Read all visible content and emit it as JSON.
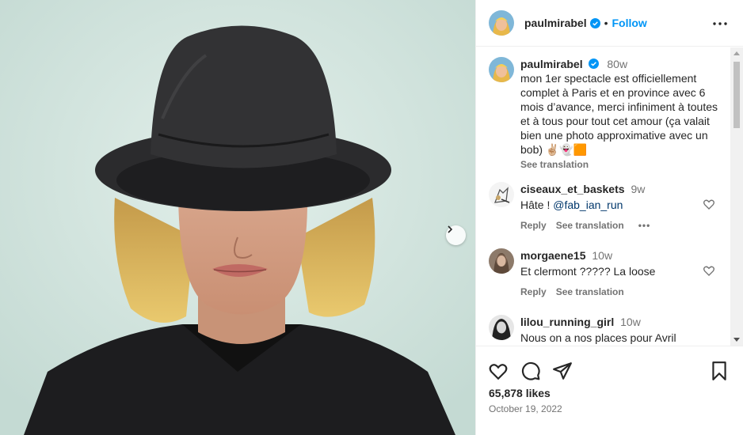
{
  "post": {
    "username": "paulmirabel",
    "follow_label": "Follow",
    "separator": "•",
    "caption_time": "80w",
    "caption": "mon 1er spectacle est officiellement complet à Paris et en province avec 6 mois d’avance, merci infiniment à toutes et à tous pour tout cet amour (ça valait bien une photo approximative avec un bob) ✌🏼👻🟧",
    "see_translation": "See translation",
    "likes": "65,878 likes",
    "date": "October 19, 2022"
  },
  "comments": [
    {
      "username": "ciseaux_et_baskets",
      "time": "9w",
      "text": "Hâte ! ",
      "mention": "@fab_ian_run",
      "reply": "Reply",
      "see_translation": "See translation",
      "more": "•••"
    },
    {
      "username": "morgaene15",
      "time": "10w",
      "text": "Et clermont ????? La loose",
      "mention": "",
      "reply": "Reply",
      "see_translation": "See translation"
    },
    {
      "username": "lilou_running_girl",
      "time": "10w",
      "text": "Nous on a nos places pour Avril",
      "mention": ""
    }
  ],
  "icons": {
    "like": "heart-icon",
    "comment": "comment-icon",
    "share": "paper-plane-icon",
    "save": "bookmark-icon",
    "more": "more-icon",
    "next": "chevron-right-icon",
    "verified": "verified-badge-icon"
  },
  "colors": {
    "accent": "#0095f6",
    "verified": "#0095f6",
    "text": "#262626",
    "secondary": "#737373"
  }
}
